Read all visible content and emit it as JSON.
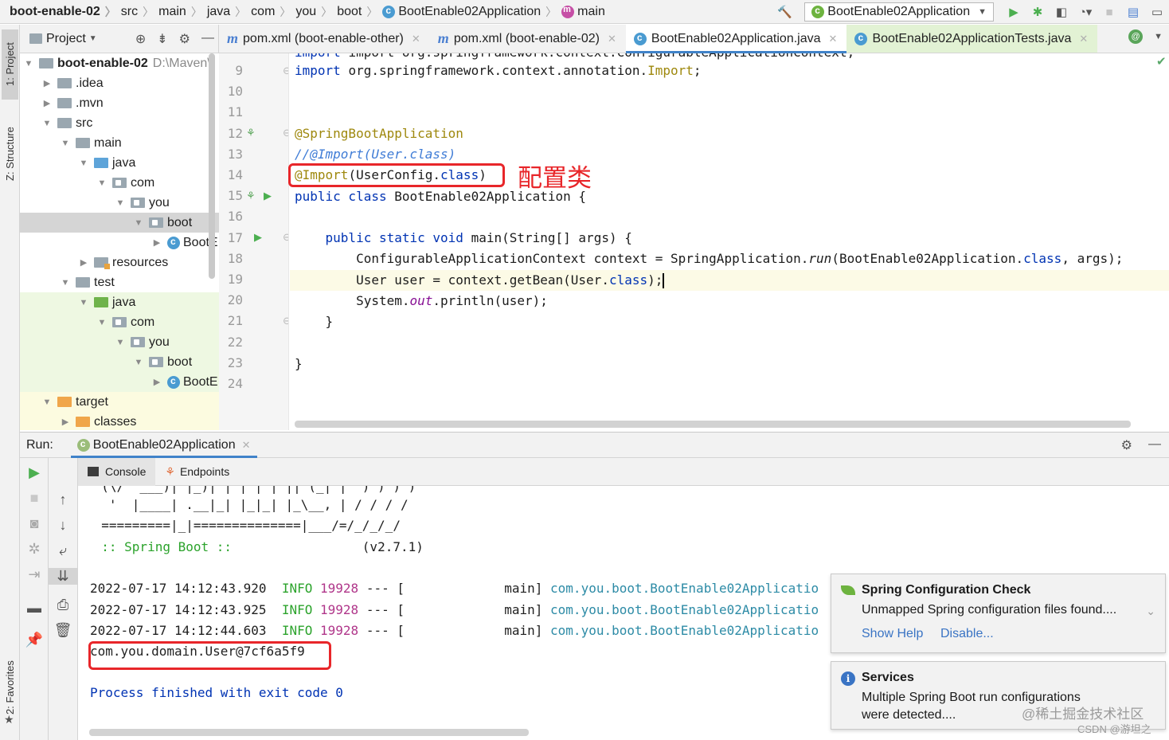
{
  "breadcrumb": [
    "boot-enable-02",
    "src",
    "main",
    "java",
    "com",
    "you",
    "boot",
    "BootEnable02Application",
    "main"
  ],
  "run_config": "BootEnable02Application",
  "left_stripe": {
    "project": "1: Project",
    "structure": "Z: Structure",
    "favorites": "2: Favorites"
  },
  "project_panel": {
    "title": "Project",
    "tree": [
      {
        "label": "boot-enable-02",
        "suffix": "D:\\Maven\\",
        "arrow": "▼",
        "icon": "gray",
        "indent": 0,
        "bold": true
      },
      {
        "label": ".idea",
        "arrow": "▶",
        "icon": "gray",
        "indent": 1
      },
      {
        "label": ".mvn",
        "arrow": "▶",
        "icon": "gray",
        "indent": 1
      },
      {
        "label": "src",
        "arrow": "▼",
        "icon": "gray",
        "indent": 1
      },
      {
        "label": "main",
        "arrow": "▼",
        "icon": "gray",
        "indent": 2
      },
      {
        "label": "java",
        "arrow": "▼",
        "icon": "blue",
        "indent": 3
      },
      {
        "label": "com",
        "arrow": "▼",
        "icon": "pkg",
        "indent": 4
      },
      {
        "label": "you",
        "arrow": "▼",
        "icon": "pkg",
        "indent": 5
      },
      {
        "label": "boot",
        "arrow": "▼",
        "icon": "pkg",
        "indent": 6,
        "selected": true
      },
      {
        "label": "BootE",
        "arrow": "▶",
        "icon": "class",
        "indent": 7
      },
      {
        "label": "resources",
        "arrow": "▶",
        "icon": "res",
        "indent": 3
      },
      {
        "label": "test",
        "arrow": "▼",
        "icon": "gray",
        "indent": 2
      },
      {
        "label": "java",
        "arrow": "▼",
        "icon": "green",
        "indent": 3,
        "green": true
      },
      {
        "label": "com",
        "arrow": "▼",
        "icon": "pkg",
        "indent": 4,
        "green": true
      },
      {
        "label": "you",
        "arrow": "▼",
        "icon": "pkg",
        "indent": 5,
        "green": true
      },
      {
        "label": "boot",
        "arrow": "▼",
        "icon": "pkg",
        "indent": 6,
        "green": true
      },
      {
        "label": "BootE",
        "arrow": "▶",
        "icon": "class",
        "indent": 7,
        "green": true
      },
      {
        "label": "target",
        "arrow": "▼",
        "icon": "orange",
        "indent": 1,
        "yellow": true
      },
      {
        "label": "classes",
        "arrow": "▶",
        "icon": "orange",
        "indent": 2,
        "yellow": true
      }
    ]
  },
  "editor_tabs": [
    {
      "label": "pom.xml (boot-enable-other)",
      "kind": "maven"
    },
    {
      "label": "pom.xml (boot-enable-02)",
      "kind": "maven"
    },
    {
      "label": "BootEnable02Application.java",
      "kind": "class",
      "active": true
    },
    {
      "label": "BootEnable02ApplicationTests.java",
      "kind": "test"
    }
  ],
  "code": {
    "line_numbers": [
      "9",
      "10",
      "11",
      "12",
      "13",
      "14",
      "15",
      "16",
      "17",
      "18",
      "19",
      "20",
      "21",
      "22",
      "23",
      "24"
    ],
    "partial_top": "import org.springframework.context.ConfigurableApplicationContext;",
    "import_line": "org.springframework.context.annotation.",
    "import_cls": "Import",
    "ann1": "@SpringBootApplication",
    "comment": "//@Import(User.class)",
    "import_ann": "@Import",
    "import_arg": "(UserConfig.",
    "class_kw": "class",
    "close_paren": ")",
    "class_decl": "BootEnable02Application {",
    "main_sig": "main(String[] args) {",
    "ctx_line_a": "ConfigurableApplicationContext context = SpringApplication.",
    "ctx_run": "run",
    "ctx_line_b": "(BootEnable02Application.",
    "ctx_line_c": ", args);",
    "user_line_a": "User user = context.getBean(User.",
    "user_line_b": ");",
    "print_a": "System.",
    "print_out": "out",
    "print_b": ".println(user);",
    "brace": "}",
    "annotation_label": "配置类"
  },
  "run_panel": {
    "label": "Run:",
    "tab": "BootEnable02Application",
    "console_tab": "Console",
    "endpoints_tab": "Endpoints",
    "banner": [
      "  (\\/  ___)| |_)| | | | | || (_| |  ) ) ) )",
      "   '  |____| .__|_| |_|_| |_\\__, | / / / /",
      "  =========|_|==============|___/=/_/_/_/"
    ],
    "spring_label": "  :: Spring Boot ::",
    "spring_version": "(v2.7.1)",
    "logs": [
      {
        "ts": "2022-07-17 14:12:43.920",
        "level": "INFO",
        "pid": "19928",
        "sep": "--- [",
        "thread": "main]",
        "logger": "com.you.boot.BootEnable02Applicatio"
      },
      {
        "ts": "2022-07-17 14:12:43.925",
        "level": "INFO",
        "pid": "19928",
        "sep": "--- [",
        "thread": "main]",
        "logger": "com.you.boot.BootEnable02Applicatio"
      },
      {
        "ts": "2022-07-17 14:12:44.603",
        "level": "INFO",
        "pid": "19928",
        "sep": "--- [",
        "thread": "main]",
        "logger": "com.you.boot.BootEnable02Applicatio"
      }
    ],
    "user_output": "com.you.domain.User@7cf6a5f9",
    "exit_message": "Process finished with exit code 0"
  },
  "notifications": [
    {
      "title": "Spring Configuration Check",
      "body": "Unmapped Spring configuration files found....",
      "links": [
        "Show Help",
        "Disable..."
      ]
    },
    {
      "title": "Services",
      "body": "Multiple Spring Boot run configurations",
      "body2": "were detected...."
    }
  ],
  "watermark": [
    "@稀土掘金技术社区",
    "CSDN @游坦之"
  ],
  "colors": {
    "accent": "#4083c9",
    "highlight_red": "#e8262a",
    "keyword": "#0033b3",
    "annotation": "#9e880d",
    "spring_green": "#2ca32c"
  }
}
